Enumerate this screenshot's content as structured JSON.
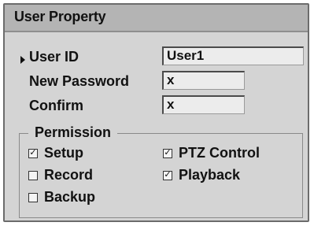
{
  "dialog": {
    "title": "User Property"
  },
  "fields": {
    "user_id": {
      "label": "User ID",
      "value": "User1"
    },
    "new_password": {
      "label": "New Password",
      "value": "x"
    },
    "confirm": {
      "label": "Confirm",
      "value": "x"
    }
  },
  "permission": {
    "title": "Permission",
    "setup": {
      "label": "Setup",
      "checked": true
    },
    "ptz_control": {
      "label": "PTZ Control",
      "checked": true
    },
    "record": {
      "label": "Record",
      "checked": false
    },
    "playback": {
      "label": "Playback",
      "checked": true
    },
    "backup": {
      "label": "Backup",
      "checked": false
    }
  }
}
